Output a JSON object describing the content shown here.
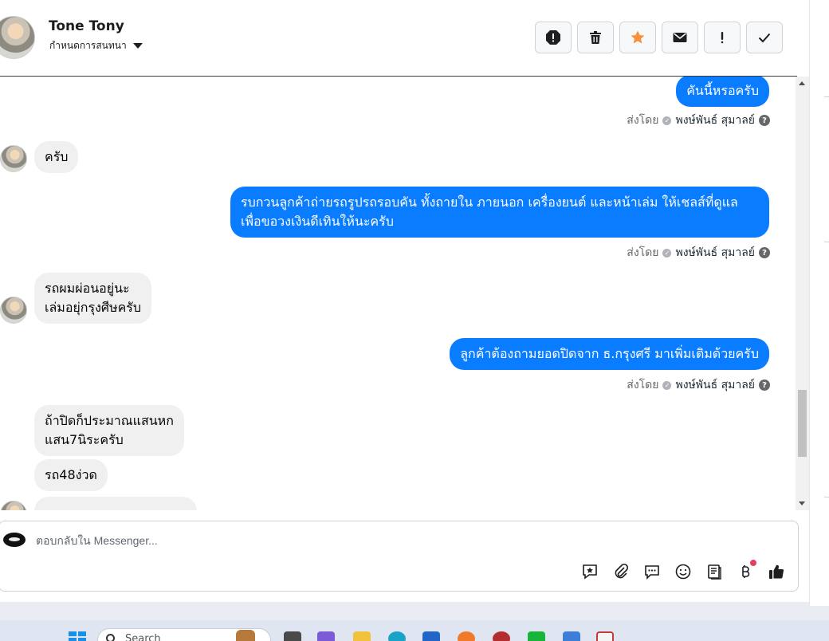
{
  "header": {
    "name": "Tone Tony",
    "assign_label": "กำหนดการสนทนา"
  },
  "toolbar": [
    {
      "name": "report-button",
      "icon": "alert-octagon-icon"
    },
    {
      "name": "delete-button",
      "icon": "trash-icon"
    },
    {
      "name": "star-button",
      "icon": "star-icon",
      "color": "#f7923a"
    },
    {
      "name": "mark-unread-button",
      "icon": "envelope-icon"
    },
    {
      "name": "follow-up-button",
      "icon": "exclamation-icon"
    },
    {
      "name": "mark-done-button",
      "icon": "check-icon"
    }
  ],
  "messages": {
    "m1": "คันนี้หรอครับ",
    "m2": "ครับ",
    "m3_line1": "รบกวนลูกค้าถ่ายรถรูปรถรอบคัน ทั้งถายใน ภายนอก เครื่องยนต์ และหน้าเล่ม ให้เชลส์ที่ดูแล",
    "m3_line2": "เพื่อขอวงเงินดีเทินให้นะครับ",
    "m4_line1": "รถผมผ่อนอยู่นะ",
    "m4_line2": "เล่มอยุ่กรุงศีษครับ",
    "m5": "ลูกค้าต้องถามยอดปิดจาก ธ.กรุงศรี มาเพิ่มเติมด้วยครับ",
    "m6_line1": "ถ้าปิดก็ประมาณแสนหก",
    "m6_line2": "แสน7นิระครับ",
    "m7": "รถ48ง่วด"
  },
  "sent_by": {
    "label": "ส่งโดย",
    "sender": "พงษ์พันธ์ สุมาลย์",
    "help": "?"
  },
  "composer": {
    "placeholder": "ตอบกลับใน Messenger..."
  },
  "composer_icons": [
    "saved-reply-icon",
    "attachment-icon",
    "chat-bubbles-icon",
    "emoji-icon",
    "notes-icon",
    "baht-payment-icon",
    "thumbs-up-icon"
  ],
  "taskbar": {
    "search_label": "Search"
  },
  "colors": {
    "outgoing_bubble": "#0a7cff",
    "incoming_bubble": "#f0f0f0",
    "notification_dot": "#e4405f"
  }
}
